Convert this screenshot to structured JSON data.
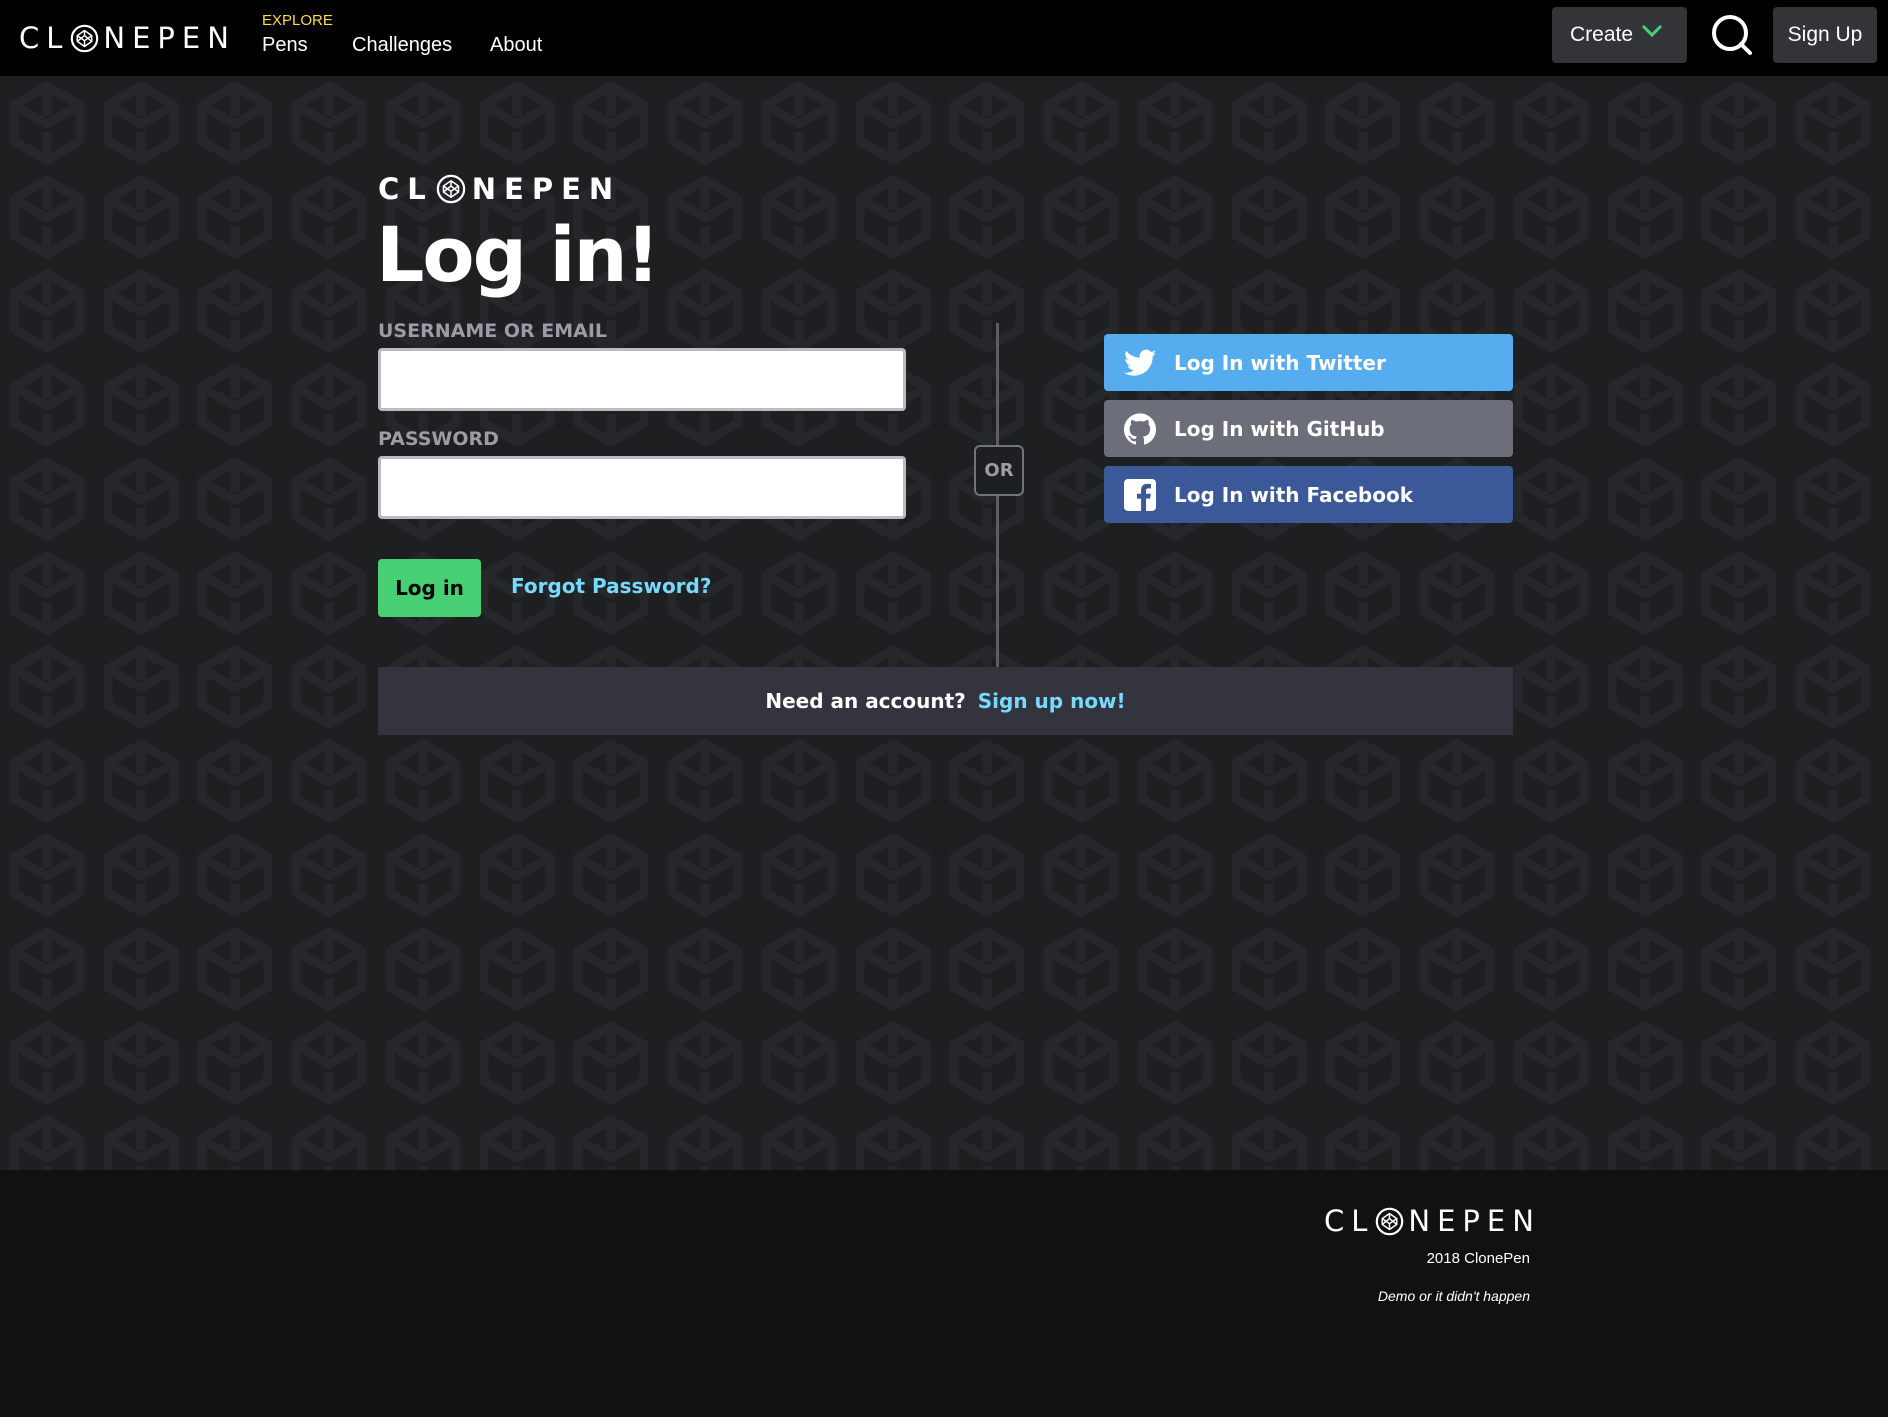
{
  "header": {
    "logo_text_left": "CL",
    "logo_text_right": "NEPEN",
    "explore_label": "EXPLORE",
    "nav": {
      "pens": "Pens",
      "challenges": "Challenges",
      "about": "About"
    },
    "create_label": "Create",
    "signup_label": "Sign Up"
  },
  "login": {
    "logo_text_left": "CL",
    "logo_text_right": "NEPEN",
    "title": "Log in!",
    "username_label": "USERNAME OR EMAIL",
    "username_value": "",
    "password_label": "PASSWORD",
    "password_value": "",
    "login_button": "Log in",
    "forgot_link": "Forgot Password?",
    "or_label": "OR",
    "social": {
      "twitter": "Log In with Twitter",
      "github": "Log In with GitHub",
      "facebook": "Log In with Facebook"
    },
    "need_account_text": "Need an account?",
    "signup_link": "Sign up now!"
  },
  "footer": {
    "logo_text_left": "CL",
    "logo_text_right": "NEPEN",
    "copyright": "2018 ClonePen",
    "tagline": "Demo or it didn't happen"
  },
  "colors": {
    "accent_green": "#47cf73",
    "link_blue": "#76daff",
    "explore_yellow": "#ffdd40",
    "twitter": "#55acee",
    "github": "#6c6e7a",
    "facebook": "#3b5998"
  },
  "icons": [
    "codepen-logo-icon",
    "chevron-down-icon",
    "search-icon",
    "twitter-icon",
    "github-icon",
    "facebook-icon"
  ]
}
